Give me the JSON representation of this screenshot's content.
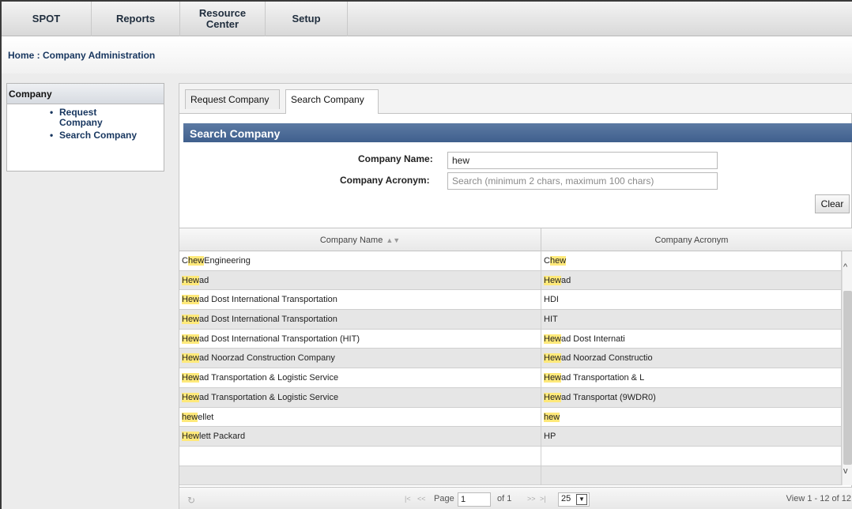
{
  "nav": {
    "items": [
      "SPOT",
      "Reports",
      "Resource Center",
      "Setup"
    ]
  },
  "breadcrumb": {
    "home": "Home",
    "separator": " : ",
    "current": "Company Administration"
  },
  "sidebar": {
    "title": "Company",
    "items": [
      "Request Company",
      "Search Company"
    ]
  },
  "tabs": [
    "Request Company",
    "Search Company"
  ],
  "active_tab": "Search Company",
  "search": {
    "header": "Search Company",
    "name_label": "Company Name:",
    "name_value": "hew",
    "acronym_label": "Company Acronym:",
    "acronym_placeholder": "Search (minimum 2 chars, maximum 100 chars)",
    "acronym_value": "",
    "clear_label": "Clear"
  },
  "grid": {
    "columns": [
      "Company Name",
      "Company Acronym"
    ],
    "sort_indicator": "▲▼",
    "rows": [
      {
        "name_pre": "C",
        "name_hl": "hew",
        "name_post": " Engineering",
        "acr_pre": "C",
        "acr_hl": "hew",
        "acr_post": ""
      },
      {
        "name_pre": "",
        "name_hl": "Hew",
        "name_post": "ad",
        "acr_pre": "",
        "acr_hl": "Hew",
        "acr_post": "ad"
      },
      {
        "name_pre": "",
        "name_hl": "Hew",
        "name_post": "ad Dost International Transportation",
        "acr_pre": "HDI",
        "acr_hl": "",
        "acr_post": ""
      },
      {
        "name_pre": "",
        "name_hl": "Hew",
        "name_post": "ad Dost International Transportation",
        "acr_pre": "HIT",
        "acr_hl": "",
        "acr_post": ""
      },
      {
        "name_pre": "",
        "name_hl": "Hew",
        "name_post": "ad Dost International Transportation (HIT)",
        "acr_pre": "",
        "acr_hl": "Hew",
        "acr_post": "ad Dost Internati"
      },
      {
        "name_pre": "",
        "name_hl": "Hew",
        "name_post": "ad Noorzad Construction Company",
        "acr_pre": "",
        "acr_hl": "Hew",
        "acr_post": "ad Noorzad Constructio"
      },
      {
        "name_pre": "",
        "name_hl": "Hew",
        "name_post": "ad Transportation & Logistic Service",
        "acr_pre": "",
        "acr_hl": "Hew",
        "acr_post": "ad Transportation & L"
      },
      {
        "name_pre": "",
        "name_hl": "Hew",
        "name_post": "ad Transportation & Logistic Service",
        "acr_pre": "",
        "acr_hl": "Hew",
        "acr_post": "ad Transportat (9WDR0)"
      },
      {
        "name_pre": "",
        "name_hl": "hew",
        "name_post": "ellet",
        "acr_pre": "",
        "acr_hl": "hew",
        "acr_post": ""
      },
      {
        "name_pre": "",
        "name_hl": "Hew",
        "name_post": "lett Packard",
        "acr_pre": "HP",
        "acr_hl": "",
        "acr_post": ""
      },
      {
        "name_pre": "",
        "name_hl": "",
        "name_post": "",
        "acr_pre": "",
        "acr_hl": "",
        "acr_post": ""
      },
      {
        "name_pre": "",
        "name_hl": "",
        "name_post": "",
        "acr_pre": "",
        "acr_hl": "",
        "acr_post": ""
      }
    ]
  },
  "pager": {
    "page_label": "Page",
    "page_value": "1",
    "of_label": "of 1",
    "page_size": "25",
    "view_text": "View 1 - 12 of 12"
  },
  "icons": {
    "refresh": "refresh-icon",
    "first": "first-page-icon",
    "prev": "prev-page-icon",
    "next": "next-page-icon",
    "last": "last-page-icon"
  },
  "colors": {
    "section_header": "#4a6a96",
    "highlight": "#ffe97a",
    "link": "#17365f"
  }
}
